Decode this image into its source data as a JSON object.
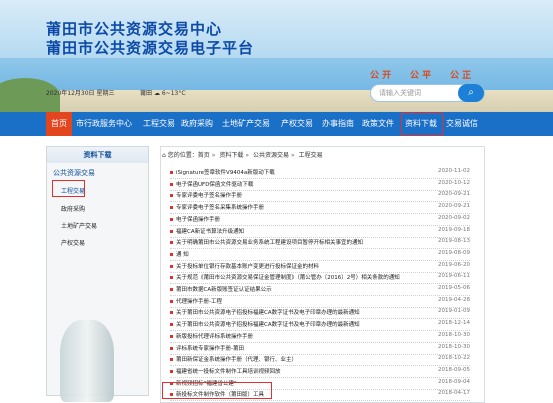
{
  "header": {
    "title_line1": "莆田市公共资源交易中心",
    "title_line2": "莆田市公共资源交易电子平台",
    "slogans": [
      "公 开",
      "公 平",
      "公 正"
    ],
    "date_text": "2020年12月30日 星期三",
    "weather_city": "莆田",
    "weather_temp": "6~13°C",
    "search_placeholder": "请输入关键词",
    "search_icon": "magnifier-icon"
  },
  "nav": {
    "items": [
      "首页",
      "市行政服务中心",
      "工程交易",
      "政府采购",
      "土地矿产交易",
      "产权交易",
      "办事指南",
      "政策文件",
      "资料下载",
      "交易诚信"
    ]
  },
  "sidebar": {
    "title": "资料下载",
    "category": "公共资源交易",
    "subitems": [
      "工程交易",
      "政府采购",
      "土地矿产交易",
      "产权交易"
    ]
  },
  "breadcrumb": {
    "prefix": "您的位置：首页",
    "items": [
      "资料下载",
      "公共资源交易",
      "工程交易"
    ]
  },
  "list": [
    {
      "title": "iSignature签章软件V9404a新版动下载",
      "date": "2020-11-02"
    },
    {
      "title": "电子保函UFD保函文件驱动下载",
      "date": "2020-10-12"
    },
    {
      "title": "专家评委电子签名操作手册",
      "date": "2020-09-21"
    },
    {
      "title": "专家评委电子签名采集系统操作手册",
      "date": "2020-09-21"
    },
    {
      "title": "电子保函操作手册",
      "date": "2020-09-02"
    },
    {
      "title": "福建CA新证书算法升级通知",
      "date": "2019-09-18"
    },
    {
      "title": "关于明确莆田市公共资源交易业务系统工程建设项目暂停开标相关事宜的通知",
      "date": "2019-08-13"
    },
    {
      "title": "通 知",
      "date": "2019-08-09"
    },
    {
      "title": "关于投标单位银行存款基本账户变更进行投标保证金的材料",
      "date": "2019-06-20"
    },
    {
      "title": "关于规范《莆田市公共资源交易保证金管理制度》（莆公管办〔2016〕2号）相关条款的通知",
      "date": "2019-06-11"
    },
    {
      "title": "莆田市数据CA新版账签证认证结果公示",
      "date": "2019-05-06"
    },
    {
      "title": "代理操作手册-工程",
      "date": "2019-04-28"
    },
    {
      "title": "关于莆田市公共资源电子招投标福建CA数字证书及电子印章办理的最新通知",
      "date": "2019-01-09"
    },
    {
      "title": "关于莆田市公共资源电子招投标福建CA数字证书及电子印章办理的最新通知",
      "date": "2018-12-14"
    },
    {
      "title": "新版投标代理评标系统操作手册",
      "date": "2018-10-30"
    },
    {
      "title": "评标系统专家操作手册-莆田",
      "date": "2018-10-30"
    },
    {
      "title": "莆田新保证金系统操作手册（代理、银行、业主）",
      "date": "2018-10-22"
    },
    {
      "title": "福建省统一投标文件制作工具培训视频回放",
      "date": "2018-09-05"
    },
    {
      "title": "新视频招标“福建省公建”",
      "date": "2018-09-04"
    },
    {
      "title": "新投标文件制作软件（莆田版）工具",
      "date": "2018-04-17"
    }
  ]
}
